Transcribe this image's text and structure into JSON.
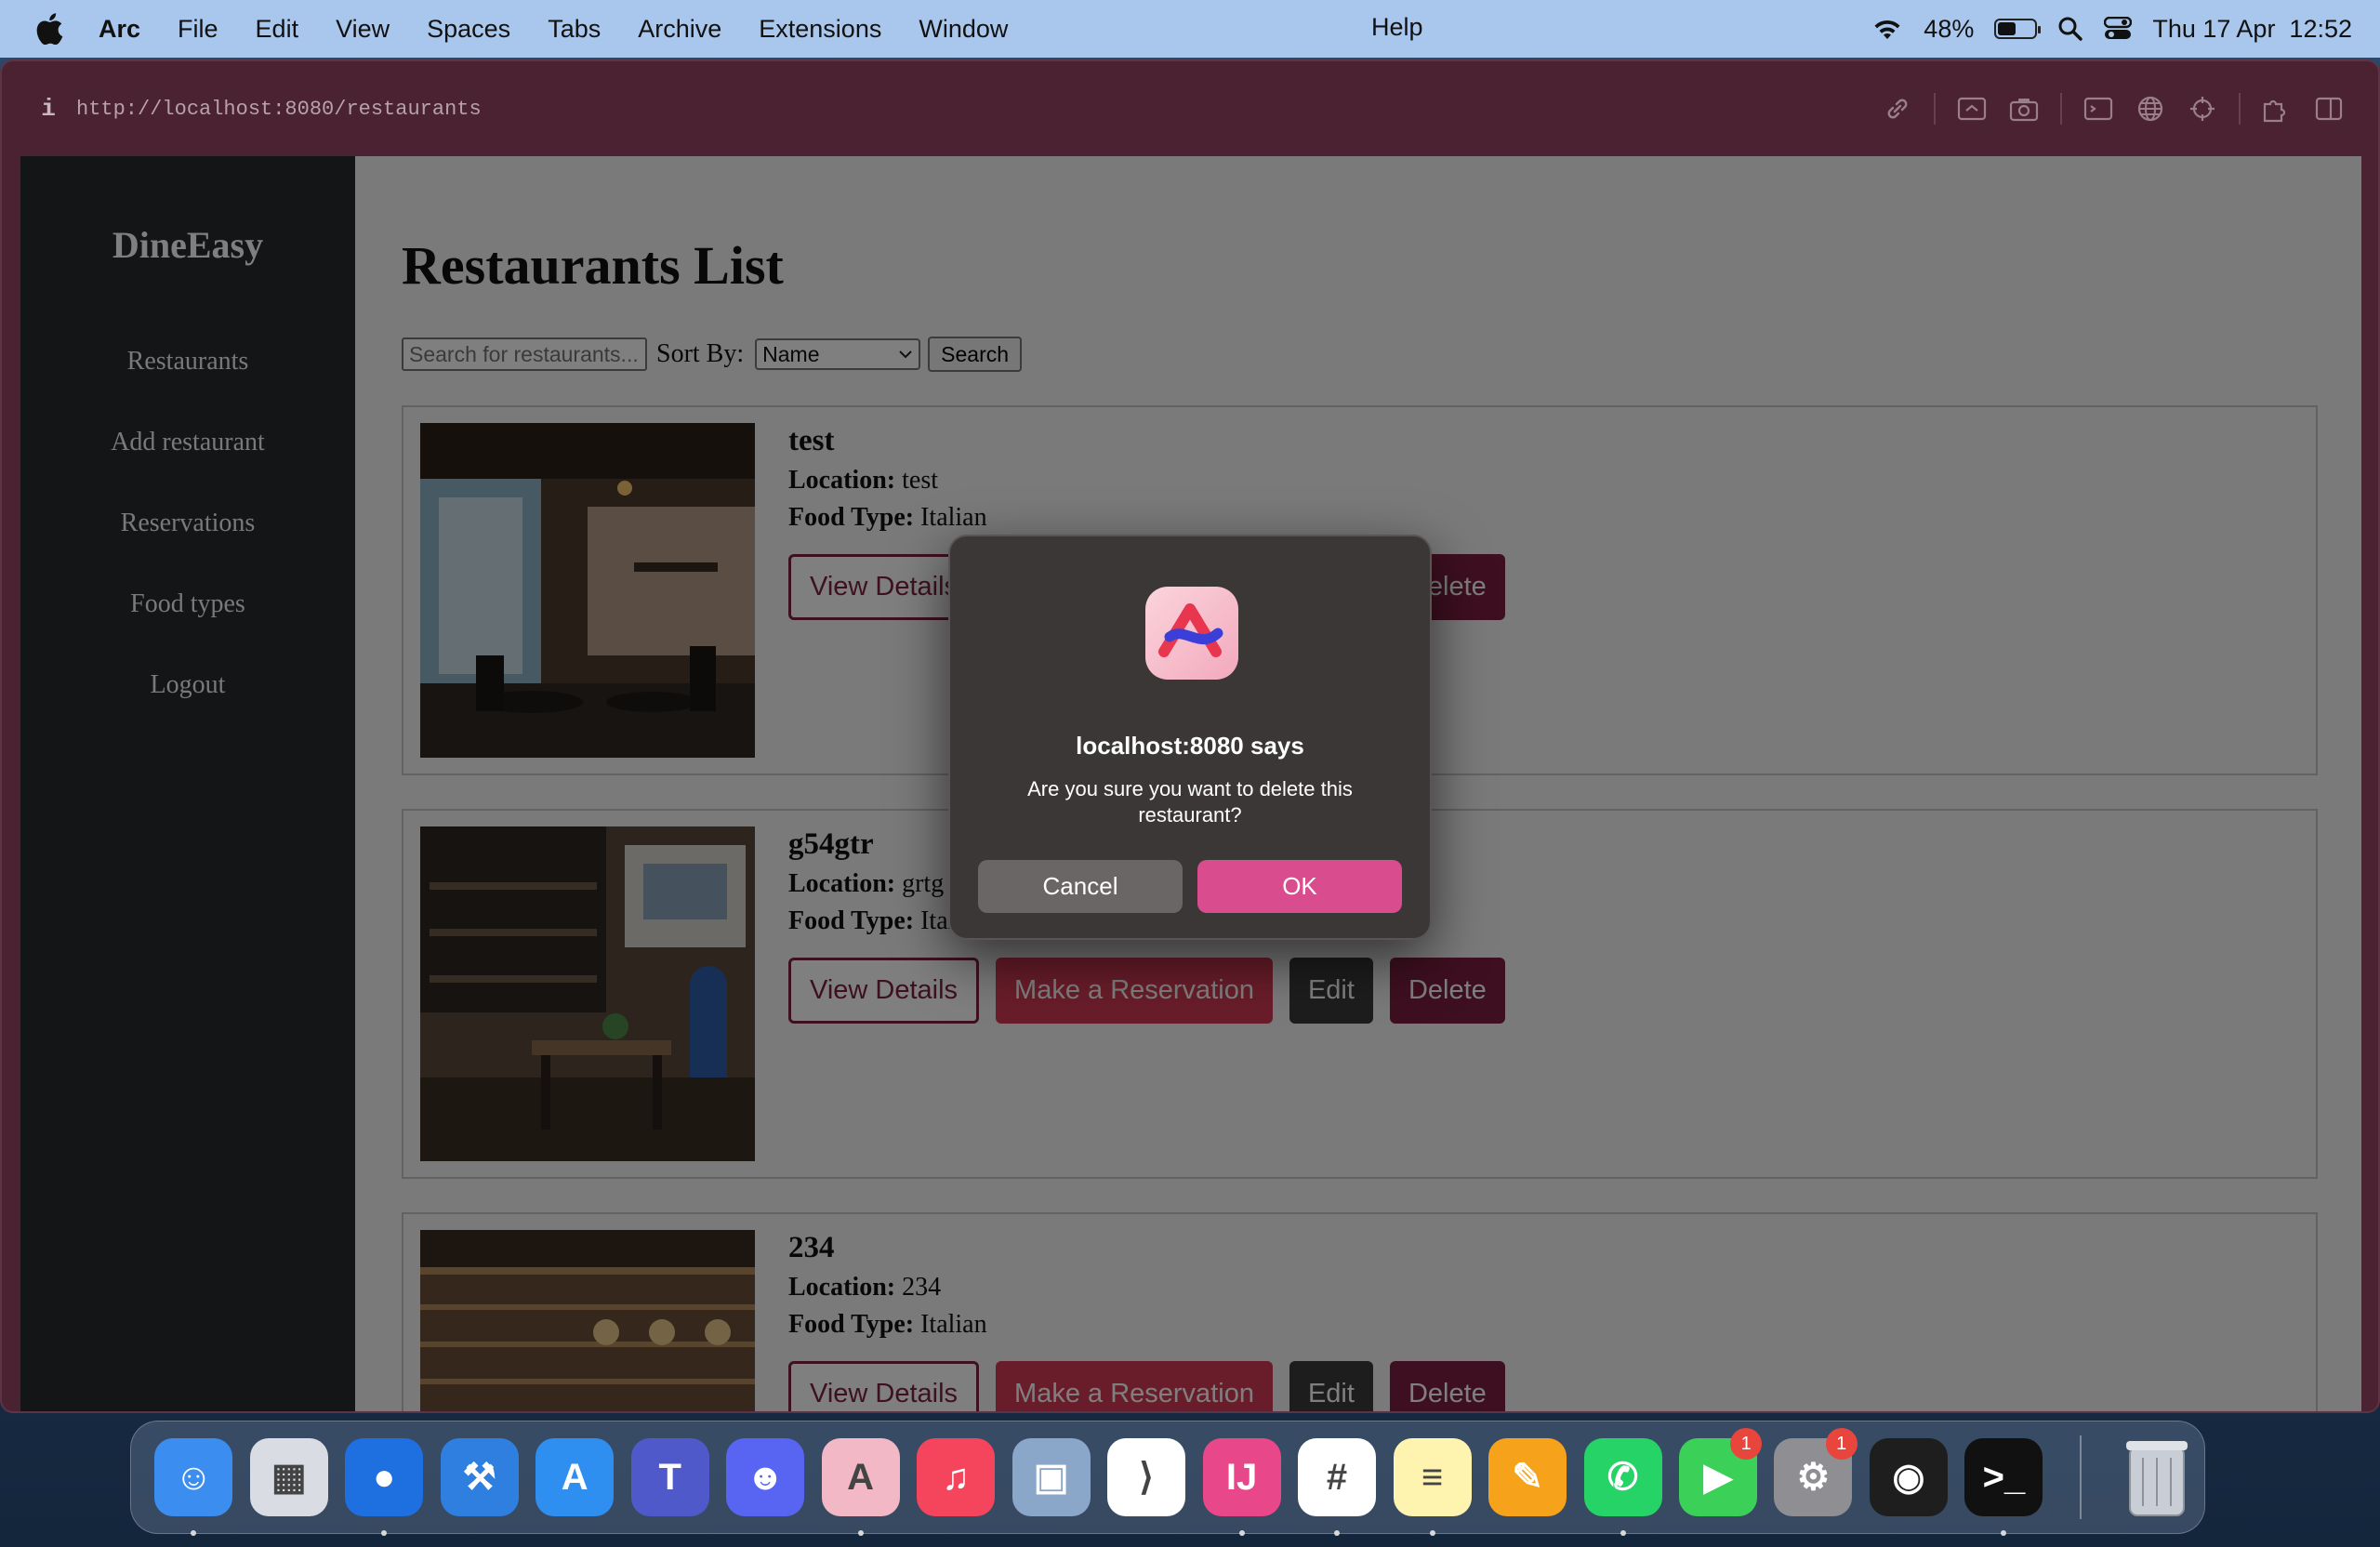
{
  "menubar": {
    "app_name": "Arc",
    "items": [
      "File",
      "Edit",
      "View",
      "Spaces",
      "Tabs",
      "Archive",
      "Extensions",
      "Window"
    ],
    "help": "Help",
    "battery_percent": "48%",
    "battery_level": 0.48,
    "datetime": "Thu 17 Apr  12:52"
  },
  "browser": {
    "url": "http://localhost:8080/restaurants",
    "info_icon": "i"
  },
  "sidebar": {
    "brand": "DineEasy",
    "items": [
      {
        "label": "Restaurants"
      },
      {
        "label": "Add restaurant"
      },
      {
        "label": "Reservations"
      },
      {
        "label": "Food types"
      },
      {
        "label": "Logout"
      }
    ]
  },
  "main": {
    "title": "Restaurants List",
    "search_placeholder": "Search for restaurants...",
    "sort_label": "Sort By:",
    "sort_value": "Name",
    "search_button": "Search",
    "location_label": "Location:",
    "food_type_label": "Food Type:",
    "buttons": {
      "details": "View Details",
      "reserve": "Make a Reservation",
      "edit": "Edit",
      "delete": "Delete"
    },
    "restaurants": [
      {
        "name": "test",
        "location": "test",
        "food_type": "Italian"
      },
      {
        "name": "g54gtr",
        "location": "grtg",
        "food_type": "Italian"
      },
      {
        "name": "234",
        "location": "234",
        "food_type": "Italian"
      }
    ]
  },
  "dialog": {
    "title": "localhost:8080 says",
    "message": "Are you sure you want to delete this restaurant?",
    "cancel": "Cancel",
    "ok": "OK"
  },
  "dock": {
    "apps": [
      {
        "name": "Finder",
        "icon": "finder-icon",
        "color": "#3b8ef0",
        "running": true
      },
      {
        "name": "Launchpad",
        "icon": "launchpad-icon",
        "color": "#d9dde3",
        "running": false
      },
      {
        "name": "Maps Pin",
        "icon": "location-pin-icon",
        "color": "#1e6fe0",
        "running": true
      },
      {
        "name": "Xcode",
        "icon": "xcode-icon",
        "color": "#2f7fe0",
        "running": false
      },
      {
        "name": "App Store",
        "icon": "app-store-icon",
        "color": "#2e8ff0",
        "running": false
      },
      {
        "name": "Teams",
        "icon": "teams-icon",
        "color": "#5059c9",
        "running": false
      },
      {
        "name": "Discord",
        "icon": "discord-icon",
        "color": "#5865f2",
        "running": false
      },
      {
        "name": "Arc",
        "icon": "arc-icon",
        "color": "#f2b8c6",
        "running": true
      },
      {
        "name": "Music",
        "icon": "music-icon",
        "color": "#f5455c",
        "running": false
      },
      {
        "name": "Preview",
        "icon": "preview-icon",
        "color": "#8aa6c8",
        "running": false
      },
      {
        "name": "VS Code",
        "icon": "vscode-icon",
        "color": "#ffffff",
        "running": false
      },
      {
        "name": "IntelliJ IDEA",
        "icon": "intellij-icon",
        "color": "#e8488a",
        "running": true
      },
      {
        "name": "Slack",
        "icon": "slack-icon",
        "color": "#ffffff",
        "running": true
      },
      {
        "name": "Notes",
        "icon": "notes-icon",
        "color": "#fff3b0",
        "running": true
      },
      {
        "name": "Pages",
        "icon": "pages-icon",
        "color": "#f7a21b",
        "running": false
      },
      {
        "name": "WhatsApp",
        "icon": "whatsapp-icon",
        "color": "#25d366",
        "running": true
      },
      {
        "name": "FaceTime",
        "icon": "facetime-icon",
        "color": "#3bd159",
        "running": false,
        "badge": "1"
      },
      {
        "name": "System Settings",
        "icon": "settings-gear-icon",
        "color": "#8e8e93",
        "running": false,
        "badge": "1"
      },
      {
        "name": "Figma",
        "icon": "figma-icon",
        "color": "#1e1e1e",
        "running": false
      },
      {
        "name": "Terminal",
        "icon": "terminal-icon",
        "color": "#111111",
        "running": true
      }
    ],
    "trash": {
      "name": "Trash",
      "icon": "trash-icon"
    }
  }
}
